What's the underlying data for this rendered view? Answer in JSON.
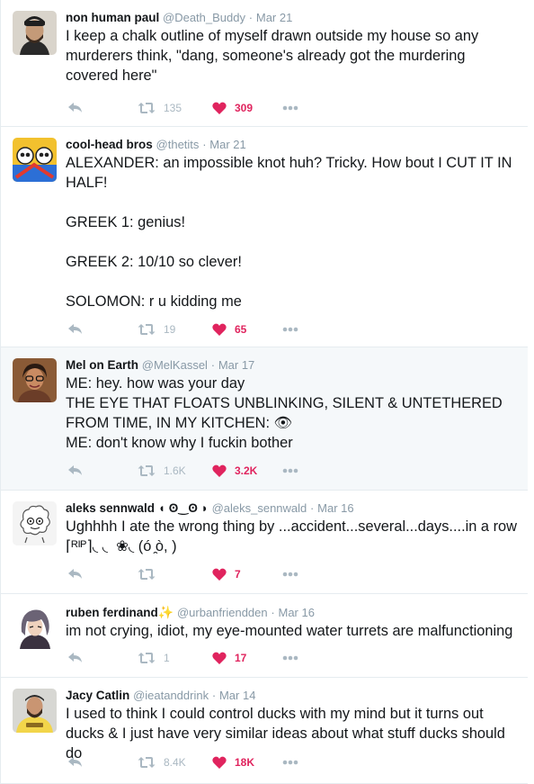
{
  "colors": {
    "like": "#e0245e",
    "icon": "#aab8c2",
    "meta": "#8899a6",
    "border": "#e6ecf0",
    "highlight_bg": "#f5f8fa"
  },
  "icons": {
    "reply": "reply-icon",
    "retweet": "retweet-icon",
    "like": "heart-icon",
    "more": "more-icon"
  },
  "tweets": [
    {
      "name": "non human paul",
      "handle": "@Death_Buddy",
      "time": "Mar 21",
      "text": "I keep a chalk outline of myself drawn outside my house so any murderers think, \"dang, someone's already got the murdering covered here\"",
      "retweets": "135",
      "likes": "309"
    },
    {
      "name": "cool-head bros",
      "handle": "@thetits",
      "time": "Mar 21",
      "text": "ALEXANDER: an impossible knot huh? Tricky. How bout I CUT IT IN HALF!\n\nGREEK 1: genius!\n\nGREEK 2: 10/10 so clever!\n\nSOLOMON: r u kidding me",
      "retweets": "19",
      "likes": "65"
    },
    {
      "name": "Mel on Earth",
      "handle": "@MelKassel",
      "time": "Mar 17",
      "text": "ME: hey. how was your day\nTHE EYE THAT FLOATS UNBLINKING, SILENT & UNTETHERED FROM TIME, IN MY KITCHEN: 👁\nME: don't know why I fuckin bother",
      "retweets": "1.6K",
      "likes": "3.2K"
    },
    {
      "name": "aleks sennwald ◖ ʘ‿ʘ ◗",
      "handle": "@aleks_sennwald",
      "time": "Mar 16",
      "text": "Ughhhh I ate the wrong thing by ...accident...several...days....in a row\n⌈ᴿᴵᴾ⌉◟ ◟  ❀◟ (ó ̯ò, )",
      "retweets": "",
      "likes": "7"
    },
    {
      "name": "ruben ferdinand",
      "badge": "✨",
      "handle": "@urbanfriendden",
      "time": "Mar 16",
      "text": "im not crying, idiot, my eye-mounted water turrets are malfunctioning",
      "retweets": "1",
      "likes": "17"
    },
    {
      "name": "Jacy Catlin",
      "handle": "@ieatanddrink",
      "time": "Mar 14",
      "text": "I used to think I could control ducks with my mind but it turns out ducks & I just have very similar ideas about what stuff ducks should do",
      "retweets": "8.4K",
      "likes": "18K"
    }
  ]
}
